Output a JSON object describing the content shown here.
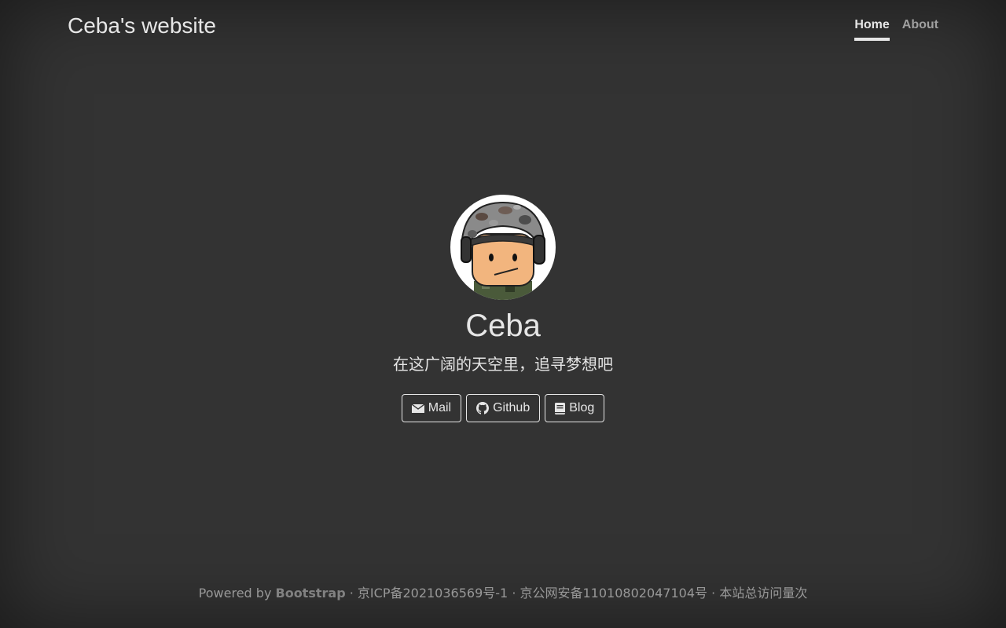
{
  "header": {
    "brand": "Ceba's website",
    "nav": [
      {
        "label": "Home",
        "active": true
      },
      {
        "label": "About",
        "active": false
      }
    ]
  },
  "profile": {
    "name": "Ceba",
    "motto": "在这广阔的天空里，追寻梦想吧",
    "avatar_icon": "soldier-avatar-icon"
  },
  "links": [
    {
      "label": "Mail",
      "icon": "envelope-icon"
    },
    {
      "label": "Github",
      "icon": "github-icon"
    },
    {
      "label": "Blog",
      "icon": "book-icon"
    }
  ],
  "footer": {
    "powered_prefix": "Powered by",
    "powered_link": "Bootstrap",
    "sep1": "·",
    "icp": "京ICP备2021036569号-1",
    "sep2": "·",
    "police": "京公网安备11010802047104号",
    "sep3": "·",
    "visits": "本站总访问量次"
  },
  "colors": {
    "background": "#333333",
    "text": "#e6e6e6"
  }
}
